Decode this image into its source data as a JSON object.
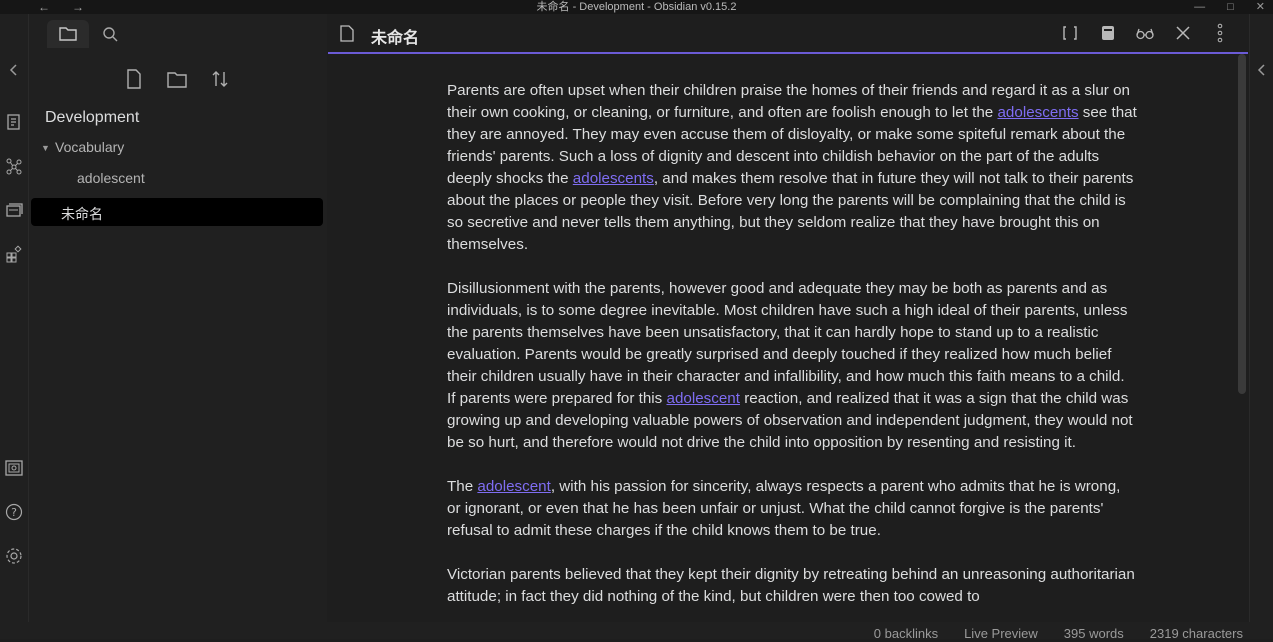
{
  "window": {
    "title": "未命名 - Development - Obsidian v0.15.2",
    "back_glyph": "←",
    "forward_glyph": "→",
    "minimize_glyph": "—",
    "maximize_glyph": "□",
    "close_glyph": "✕"
  },
  "sidebar": {
    "vault_name": "Development",
    "folder": "Vocabulary",
    "folder_toggle": "▼",
    "file_in_folder": "adolescent",
    "active_file": "未命名"
  },
  "editor": {
    "tab_title": "未命名",
    "paragraphs": [
      {
        "before": "Parents are often upset when their children praise the homes of their friends and regard it as a slur on their own cooking, or cleaning, or furniture, and often are foolish enough to let the ",
        "link1": "adolescents",
        "middle": " see that they are annoyed. They may even accuse them of disloyalty, or make some spiteful remark about the friends' parents. Such a loss of dignity and descent into childish behavior on the part of the adults deeply shocks the ",
        "link2": "adolescents",
        "after": ", and makes them resolve that in future they will not talk to their parents about the places or people they visit. Before very long the parents will be complaining that the child is so secretive and never tells them anything, but they seldom realize that they have brought this on themselves."
      },
      {
        "before": "Disillusionment with the parents, however good and adequate they may be both as parents and as individuals, is to some degree inevitable. Most children have such a high ideal of their parents, unless the parents themselves have been unsatisfactory, that it can hardly hope to stand up to a realistic evaluation. Parents would be greatly surprised and deeply touched if they realized how much belief their children usually have in their character and infallibility, and how much this faith means to a child. If parents were prepared for this ",
        "link1": "adolescent",
        "after": " reaction, and realized that it was a sign that the child was growing up and developing valuable powers of observation and independent judgment, they would not be so hurt, and therefore would not drive the child into opposition by resenting and resisting it."
      },
      {
        "before": "The ",
        "link1": "adolescent",
        "after": ", with his passion for sincerity, always respects a parent who admits that he is wrong, or ignorant, or even that he has been unfair or unjust. What the child cannot forgive is the parents' refusal to admit these charges if the child knows them to be true."
      },
      {
        "before": "Victorian parents believed that they kept their dignity by retreating behind an unreasoning authoritarian attitude; in fact they did nothing of the kind, but children were then too cowed to"
      }
    ]
  },
  "status": {
    "backlinks": "0 backlinks",
    "mode": "Live Preview",
    "words": "395 words",
    "characters": "2319 characters"
  },
  "icons": {
    "left_ribbon": [
      "collapse-left-icon",
      "quick-switcher-icon",
      "graph-view-icon",
      "templates-icon",
      "plugins-icon",
      "vault-icon",
      "help-icon",
      "settings-icon"
    ],
    "right_ribbon": [
      "collapse-right-icon"
    ]
  },
  "colors": {
    "accent": "#7f6df2",
    "background": "#1e1e1e",
    "sidebar": "#202020"
  }
}
